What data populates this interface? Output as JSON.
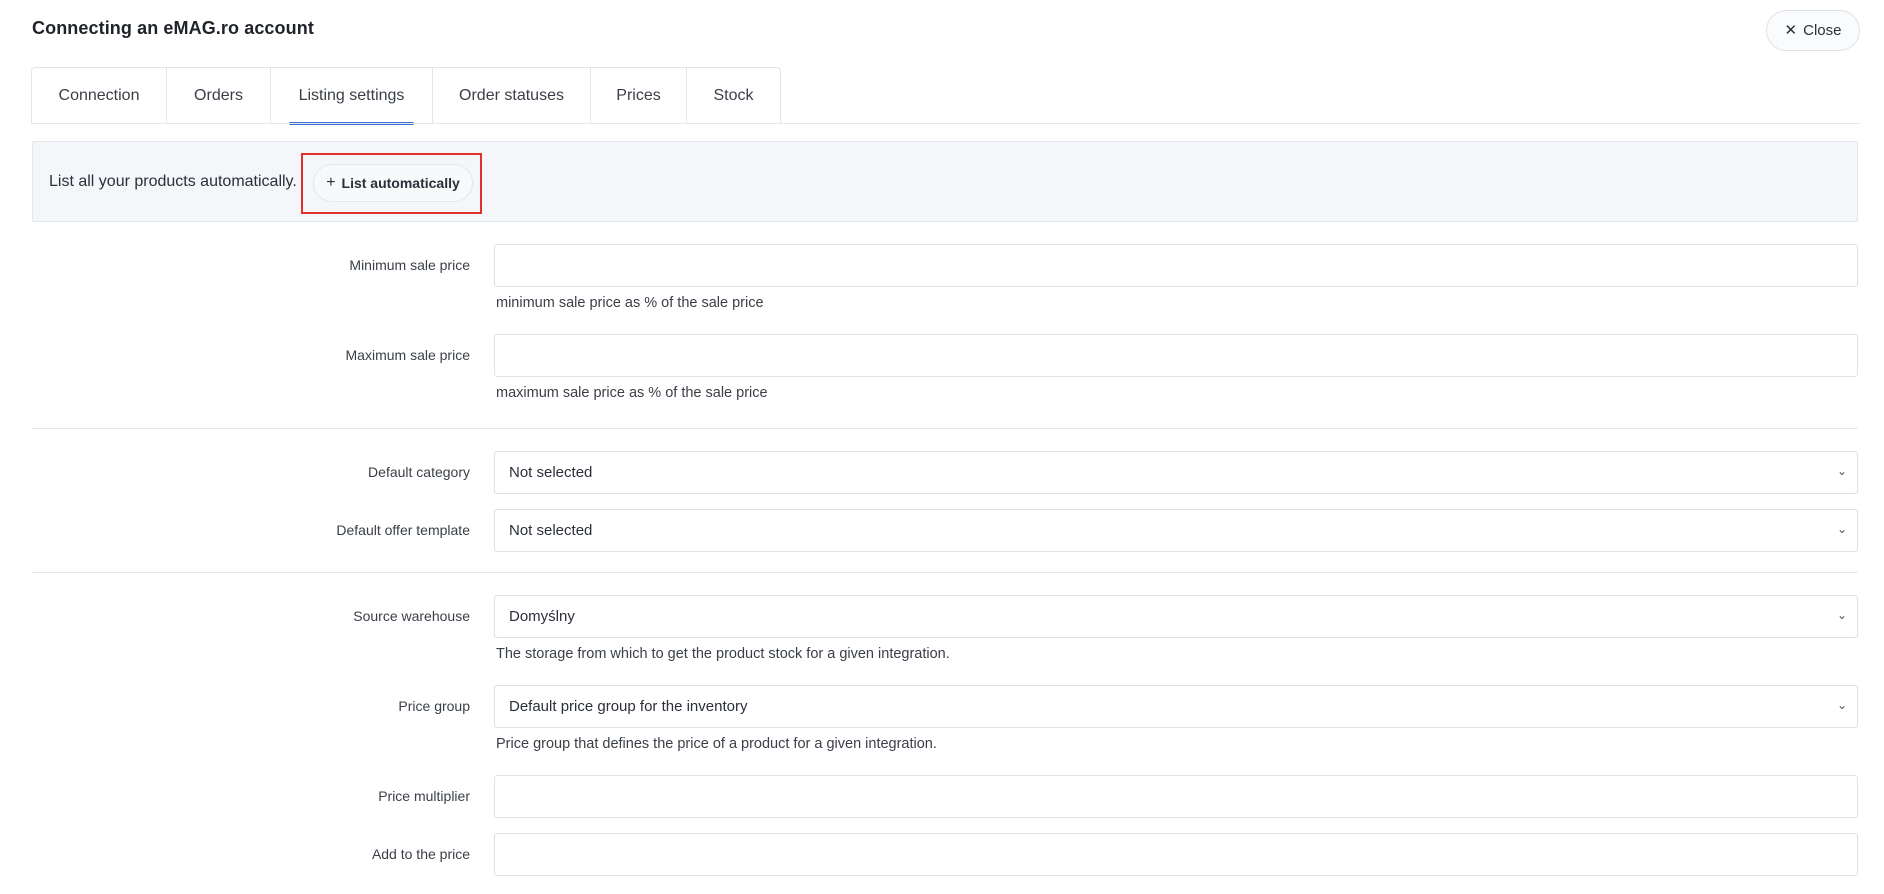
{
  "header": {
    "title": "Connecting an eMAG.ro account",
    "close_label": "Close"
  },
  "tabs": [
    {
      "label": "Connection"
    },
    {
      "label": "Orders"
    },
    {
      "label": "Listing settings",
      "active": true
    },
    {
      "label": "Order statuses"
    },
    {
      "label": "Prices"
    },
    {
      "label": "Stock"
    }
  ],
  "banner": {
    "text": "List all your products automatically.",
    "button_label": "List automatically"
  },
  "form": {
    "min_price": {
      "label": "Minimum sale price",
      "value": "",
      "hint": "minimum sale price as % of the sale price"
    },
    "max_price": {
      "label": "Maximum sale price",
      "value": "",
      "hint": "maximum sale price as % of the sale price"
    },
    "default_category": {
      "label": "Default category",
      "value": "Not selected"
    },
    "default_offer_template": {
      "label": "Default offer template",
      "value": "Not selected"
    },
    "source_warehouse": {
      "label": "Source warehouse",
      "value": "Domyślny",
      "hint": "The storage from which to get the product stock for a given integration."
    },
    "price_group": {
      "label": "Price group",
      "value": "Default price group for the inventory",
      "hint": "Price group that defines the price of a product for a given integration."
    },
    "price_multiplier": {
      "label": "Price multiplier",
      "value": ""
    },
    "add_to_price": {
      "label": "Add to the price",
      "value": ""
    }
  },
  "icons": {
    "close": "close-icon",
    "plus": "plus-icon",
    "chevron": "chevron-down-icon"
  },
  "colors": {
    "active_tab": "#3b6fd6",
    "highlight": "#e0312b",
    "banner_bg": "#f4f6f9"
  }
}
